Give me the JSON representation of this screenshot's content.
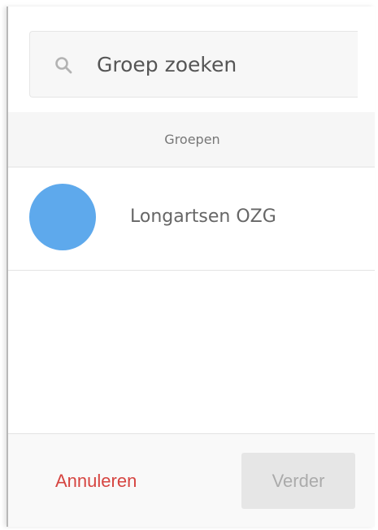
{
  "search": {
    "placeholder": "Groep zoeken",
    "value": "",
    "icon": "search-icon"
  },
  "section": {
    "title": "Groepen"
  },
  "groups": [
    {
      "name": "Longartsen OZG",
      "avatar_color": "#5ea9ec"
    }
  ],
  "footer": {
    "cancel_label": "Annuleren",
    "next_label": "Verder",
    "cancel_color": "#d64541",
    "next_disabled": true
  }
}
